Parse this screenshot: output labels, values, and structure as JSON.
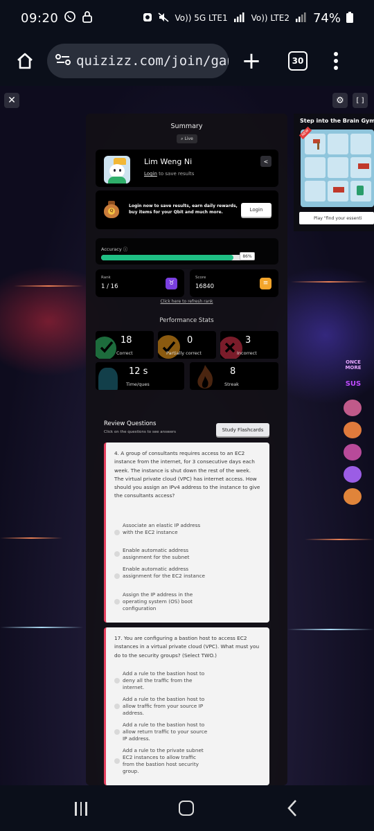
{
  "status": {
    "time": "09:20",
    "network_1": "Vo)) 5G LTE1",
    "network_2": "Vo)) LTE2",
    "battery": "74%"
  },
  "browser": {
    "url": "quizizz.com/join/gan",
    "tab_count": "30"
  },
  "summary": {
    "title": "Summary",
    "live_label": "Live",
    "user_name": "Lim Weng Ni",
    "login_link": "Login",
    "login_suffix": "to save results",
    "promo_text": "Login now to save results, earn daily rewards, buy items for your Qbit and much more.",
    "login_button": "Login",
    "accuracy_label": "Accuracy",
    "accuracy_value": "86%",
    "accuracy_fraction": 0.86,
    "rank_label": "Rank",
    "rank_value": "1 / 16",
    "score_label": "Score",
    "score_value": "16840",
    "refresh_link": "Click here to refresh rank"
  },
  "performance": {
    "title": "Performance Stats",
    "correct_value": "18",
    "correct_label": "Correct",
    "partial_value": "0",
    "partial_label": "Partially correct",
    "incorrect_value": "3",
    "incorrect_label": "Incorrect",
    "time_value": "12 s",
    "time_label": "Time/ques",
    "streak_value": "8",
    "streak_label": "Streak"
  },
  "review": {
    "title": "Review Questions",
    "subtitle": "Click on the questions to see answers",
    "flashcards_button": "Study Flashcards",
    "questions": [
      {
        "text": "4.  A group of consultants requires access to an EC2 instance from the internet, for 3 consecutive days each week. The instance is shut down the rest of the week. The virtual private cloud (VPC) has internet access. How should you assign an IPv4 address to the instance to give the consultants access?",
        "options": [
          "Associate an elastic IP address with the EC2 instance",
          "Enable automatic address assignment for the subnet",
          "Enable automatic address assignment for the EC2 instance",
          "Assign the IP address in the operating system (OS) boot configuration"
        ]
      },
      {
        "text": "17.  You are configuring a bastion host to access EC2 instances in a virtual private cloud (VPC). What must you do to the security groups? (Select TWO.)",
        "options": [
          "Add a rule to the bastion host to deny all the traffic from the internet.",
          "Add a rule to the bastion host to allow traffic from your source IP address.",
          "Add a rule to the bastion host to allow return traffic to your source IP address.",
          "Add a rule to the private subnet EC2 instances to allow traffic from the bastion host security group."
        ]
      }
    ]
  },
  "ad": {
    "title": "Step into the Brain Gym",
    "new_tag": "NEW",
    "play_button": "Play \"find your essenti"
  },
  "side_badges": {
    "once_more": "ONCE MORE",
    "sus": "SUS"
  }
}
